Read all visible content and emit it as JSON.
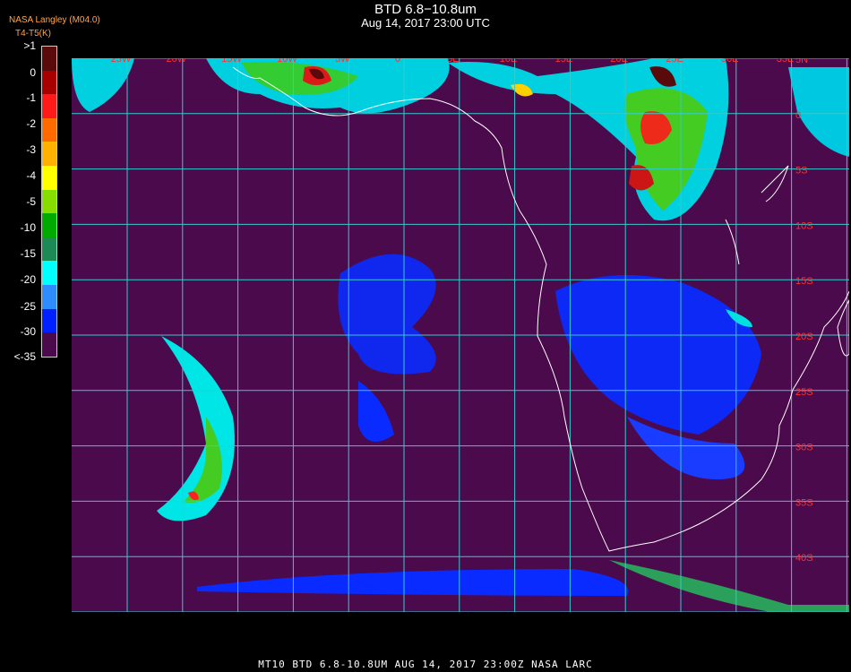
{
  "header": {
    "title": "BTD 6.8−10.8um",
    "subtitle": "Aug 14, 2017 23:00 UTC",
    "credit_line1": "NASA Langley (M04.0)",
    "credit_line2": "T4-T5(K)",
    "credit_overlap": "BTD"
  },
  "colorbar": {
    "labels": [
      ">1",
      "0",
      "-1",
      "-2",
      "-3",
      "-4",
      "-5",
      "-10",
      "-15",
      "-20",
      "-25",
      "-30",
      "<-35"
    ],
    "colors": [
      "#5a0a0a",
      "#a80000",
      "#ff1a1a",
      "#ff6a00",
      "#ffb000",
      "#ffff00",
      "#88dd00",
      "#00aa00",
      "#1d8a55",
      "#00ffff",
      "#2f8cff",
      "#0020ff",
      "#4b0a4b"
    ]
  },
  "map": {
    "background_color": "#4b0a4b",
    "grid_color": "#33cccc",
    "coast_color": "#ffffff",
    "lon_labels": [
      "25W",
      "20W",
      "15W",
      "10W",
      "5W",
      "0",
      "5E",
      "10E",
      "15E",
      "20E",
      "25E",
      "30E",
      "35E"
    ],
    "lat_labels": [
      "5N",
      "0",
      "5S",
      "10S",
      "15S",
      "20S",
      "25S",
      "30S",
      "35S",
      "40S"
    ]
  },
  "footer": {
    "text": "MT10   BTD 6.8-10.8UM    AUG 14, 2017 23:00Z   NASA LARC"
  }
}
